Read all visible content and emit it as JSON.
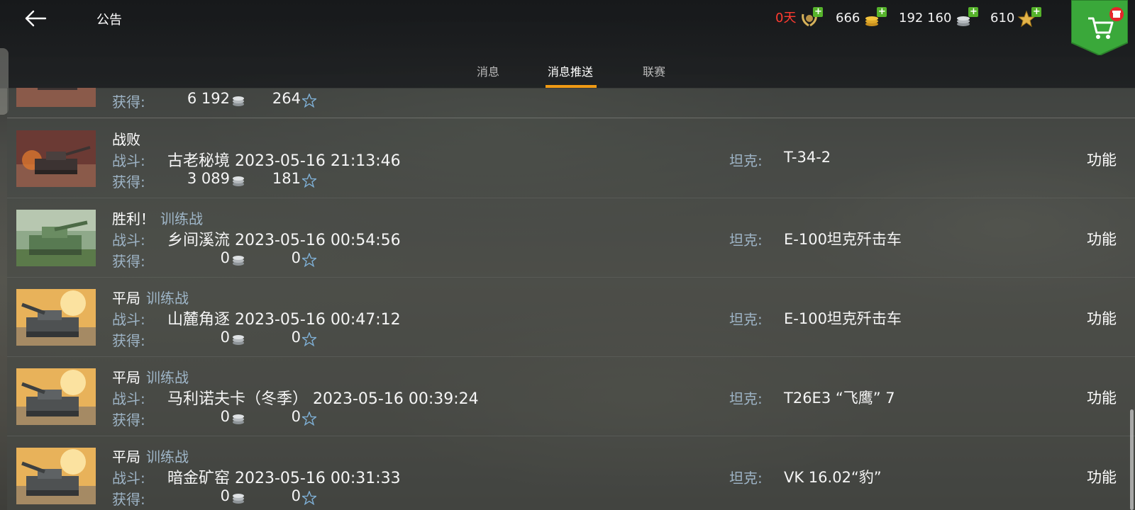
{
  "header": {
    "title": "公告",
    "currencies": [
      {
        "value": "0天",
        "icon": "premium-laurel-icon",
        "color": "#ff3b30"
      },
      {
        "value": "666",
        "icon": "gold-coins-icon",
        "color": "#f2f2f2"
      },
      {
        "value": "192 160",
        "icon": "silver-coins-icon",
        "color": "#f2f2f2"
      },
      {
        "value": "610",
        "icon": "free-xp-star-icon",
        "color": "#f2f2f2"
      }
    ],
    "plus_symbol": "+"
  },
  "tabs": [
    {
      "label": "消息",
      "active": false
    },
    {
      "label": "消息推送",
      "active": true
    },
    {
      "label": "联赛",
      "active": false
    }
  ],
  "accent_color": "#f09a14",
  "labels": {
    "battle": "战斗:",
    "earned": "获得:",
    "tank": "坦克:",
    "function_button": "功能"
  },
  "messages": [
    {
      "partial": true,
      "silver": "6 192",
      "xp": "264",
      "thumb": "burning-tank"
    },
    {
      "result": "战败",
      "mode": "",
      "battle": "古老秘境 2023-05-16 21:13:46",
      "silver": "3 089",
      "xp": "181",
      "tank": "T-34-2",
      "thumb": "burning-tank"
    },
    {
      "result": "胜利！",
      "mode": "训练战",
      "battle": "乡间溪流 2023-05-16 00:54:56",
      "silver": "0",
      "xp": "0",
      "tank": "E-100坦克歼击车",
      "thumb": "green-tank"
    },
    {
      "result": "平局",
      "mode": "训练战",
      "battle": "山麓角逐 2023-05-16 00:47:12",
      "silver": "0",
      "xp": "0",
      "tank": "E-100坦克歼击车",
      "thumb": "desert-tank"
    },
    {
      "result": "平局",
      "mode": "训练战",
      "battle": "马利诺夫卡（冬季） 2023-05-16 00:39:24",
      "silver": "0",
      "xp": "0",
      "tank": "T26E3 “飞鹰” 7",
      "thumb": "desert-tank"
    },
    {
      "result": "平局",
      "mode": "训练战",
      "battle": "暗金矿窑 2023-05-16 00:31:33",
      "silver": "0",
      "xp": "0",
      "tank": "VK 16.02“豹”",
      "thumb": "desert-tank"
    }
  ]
}
